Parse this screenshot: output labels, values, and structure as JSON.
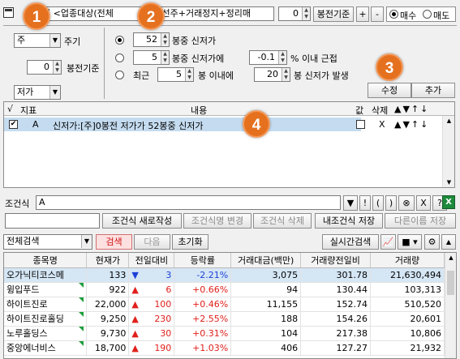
{
  "top": {
    "condition_combo": "경 <업종대상(전체",
    "condition_combo_tail": "]+우선주+거래정지+정리매",
    "bong_value": "0",
    "bong_label": "봉전기준",
    "plus_label": "+",
    "minus_label": "-",
    "buy_label": "매수",
    "sell_label": "매도"
  },
  "left": {
    "period_select": "주",
    "period_label": "주기",
    "bong_value": "0",
    "bong_label": "봉전기준",
    "price_select": "저가"
  },
  "options": {
    "opt1_value": "52",
    "opt1_label": "봉중 신저가",
    "opt2_value": "5",
    "opt2_label": "봉중 신저가에",
    "opt2_pct": "-0.1",
    "opt2_tail": "% 이내 근접",
    "opt3_prefix": "최근",
    "opt3_value": "5",
    "opt3_mid": "봉 이내에",
    "opt3_value2": "20",
    "opt3_tail": "봉 신저가 발생",
    "modify_label": "수정",
    "add_label": "추가"
  },
  "cond_table": {
    "h_check": "√",
    "h_index": "지표",
    "h_content": "내용",
    "h_value": "값",
    "h_delete": "삭제",
    "h_arrows": "▲▼↑↓",
    "row_index": "A",
    "row_content": "신저가:[주]0봉전 저가가 52봉중 신저가",
    "row_delete": "X",
    "row_arrows": "▲▼↑↓"
  },
  "formula": {
    "label": "조건식",
    "value": "A",
    "btns": [
      "▼",
      "!",
      "(",
      ")",
      "⊗",
      "X",
      "?"
    ]
  },
  "actions": {
    "new": "조건식 새로작성",
    "rename": "조건식명 변경",
    "delete": "조건식 삭제",
    "save": "내조건식 저장",
    "save_as": "다른이름 저장"
  },
  "search_bar": {
    "scope": "전체검색",
    "search": "검색",
    "next": "다음",
    "reset": "초기화",
    "realtime": "실시간검색"
  },
  "results": {
    "headers": [
      "종목명",
      "현재가",
      "전일대비",
      "등락률",
      "거래대금(백만)",
      "거래량전일비",
      "거래량"
    ],
    "rows": [
      {
        "name": "오가닉티코스메",
        "price": "133",
        "dir": "dn",
        "diff": "3",
        "rate": "-2.21%",
        "amount": "3,075",
        "ratio": "301.78",
        "volume": "21,630,494"
      },
      {
        "name": "윙입푸드",
        "price": "922",
        "dir": "up",
        "diff": "6",
        "rate": "+0.66%",
        "amount": "94",
        "ratio": "130.44",
        "volume": "103,313"
      },
      {
        "name": "하이트진로",
        "price": "22,000",
        "dir": "up",
        "diff": "100",
        "rate": "+0.46%",
        "amount": "11,155",
        "ratio": "152.74",
        "volume": "510,520"
      },
      {
        "name": "하이트진로홀딩",
        "price": "9,250",
        "dir": "up",
        "diff": "230",
        "rate": "+2.55%",
        "amount": "188",
        "ratio": "154.26",
        "volume": "20,601"
      },
      {
        "name": "노루홀딩스",
        "price": "9,730",
        "dir": "up",
        "diff": "30",
        "rate": "+0.31%",
        "amount": "104",
        "ratio": "217.38",
        "volume": "10,806"
      },
      {
        "name": "중앙에너비스",
        "price": "18,700",
        "dir": "up",
        "diff": "190",
        "rate": "+1.03%",
        "amount": "406",
        "ratio": "127.27",
        "volume": "21,932"
      }
    ]
  },
  "badges": [
    "1",
    "2",
    "3",
    "4"
  ]
}
